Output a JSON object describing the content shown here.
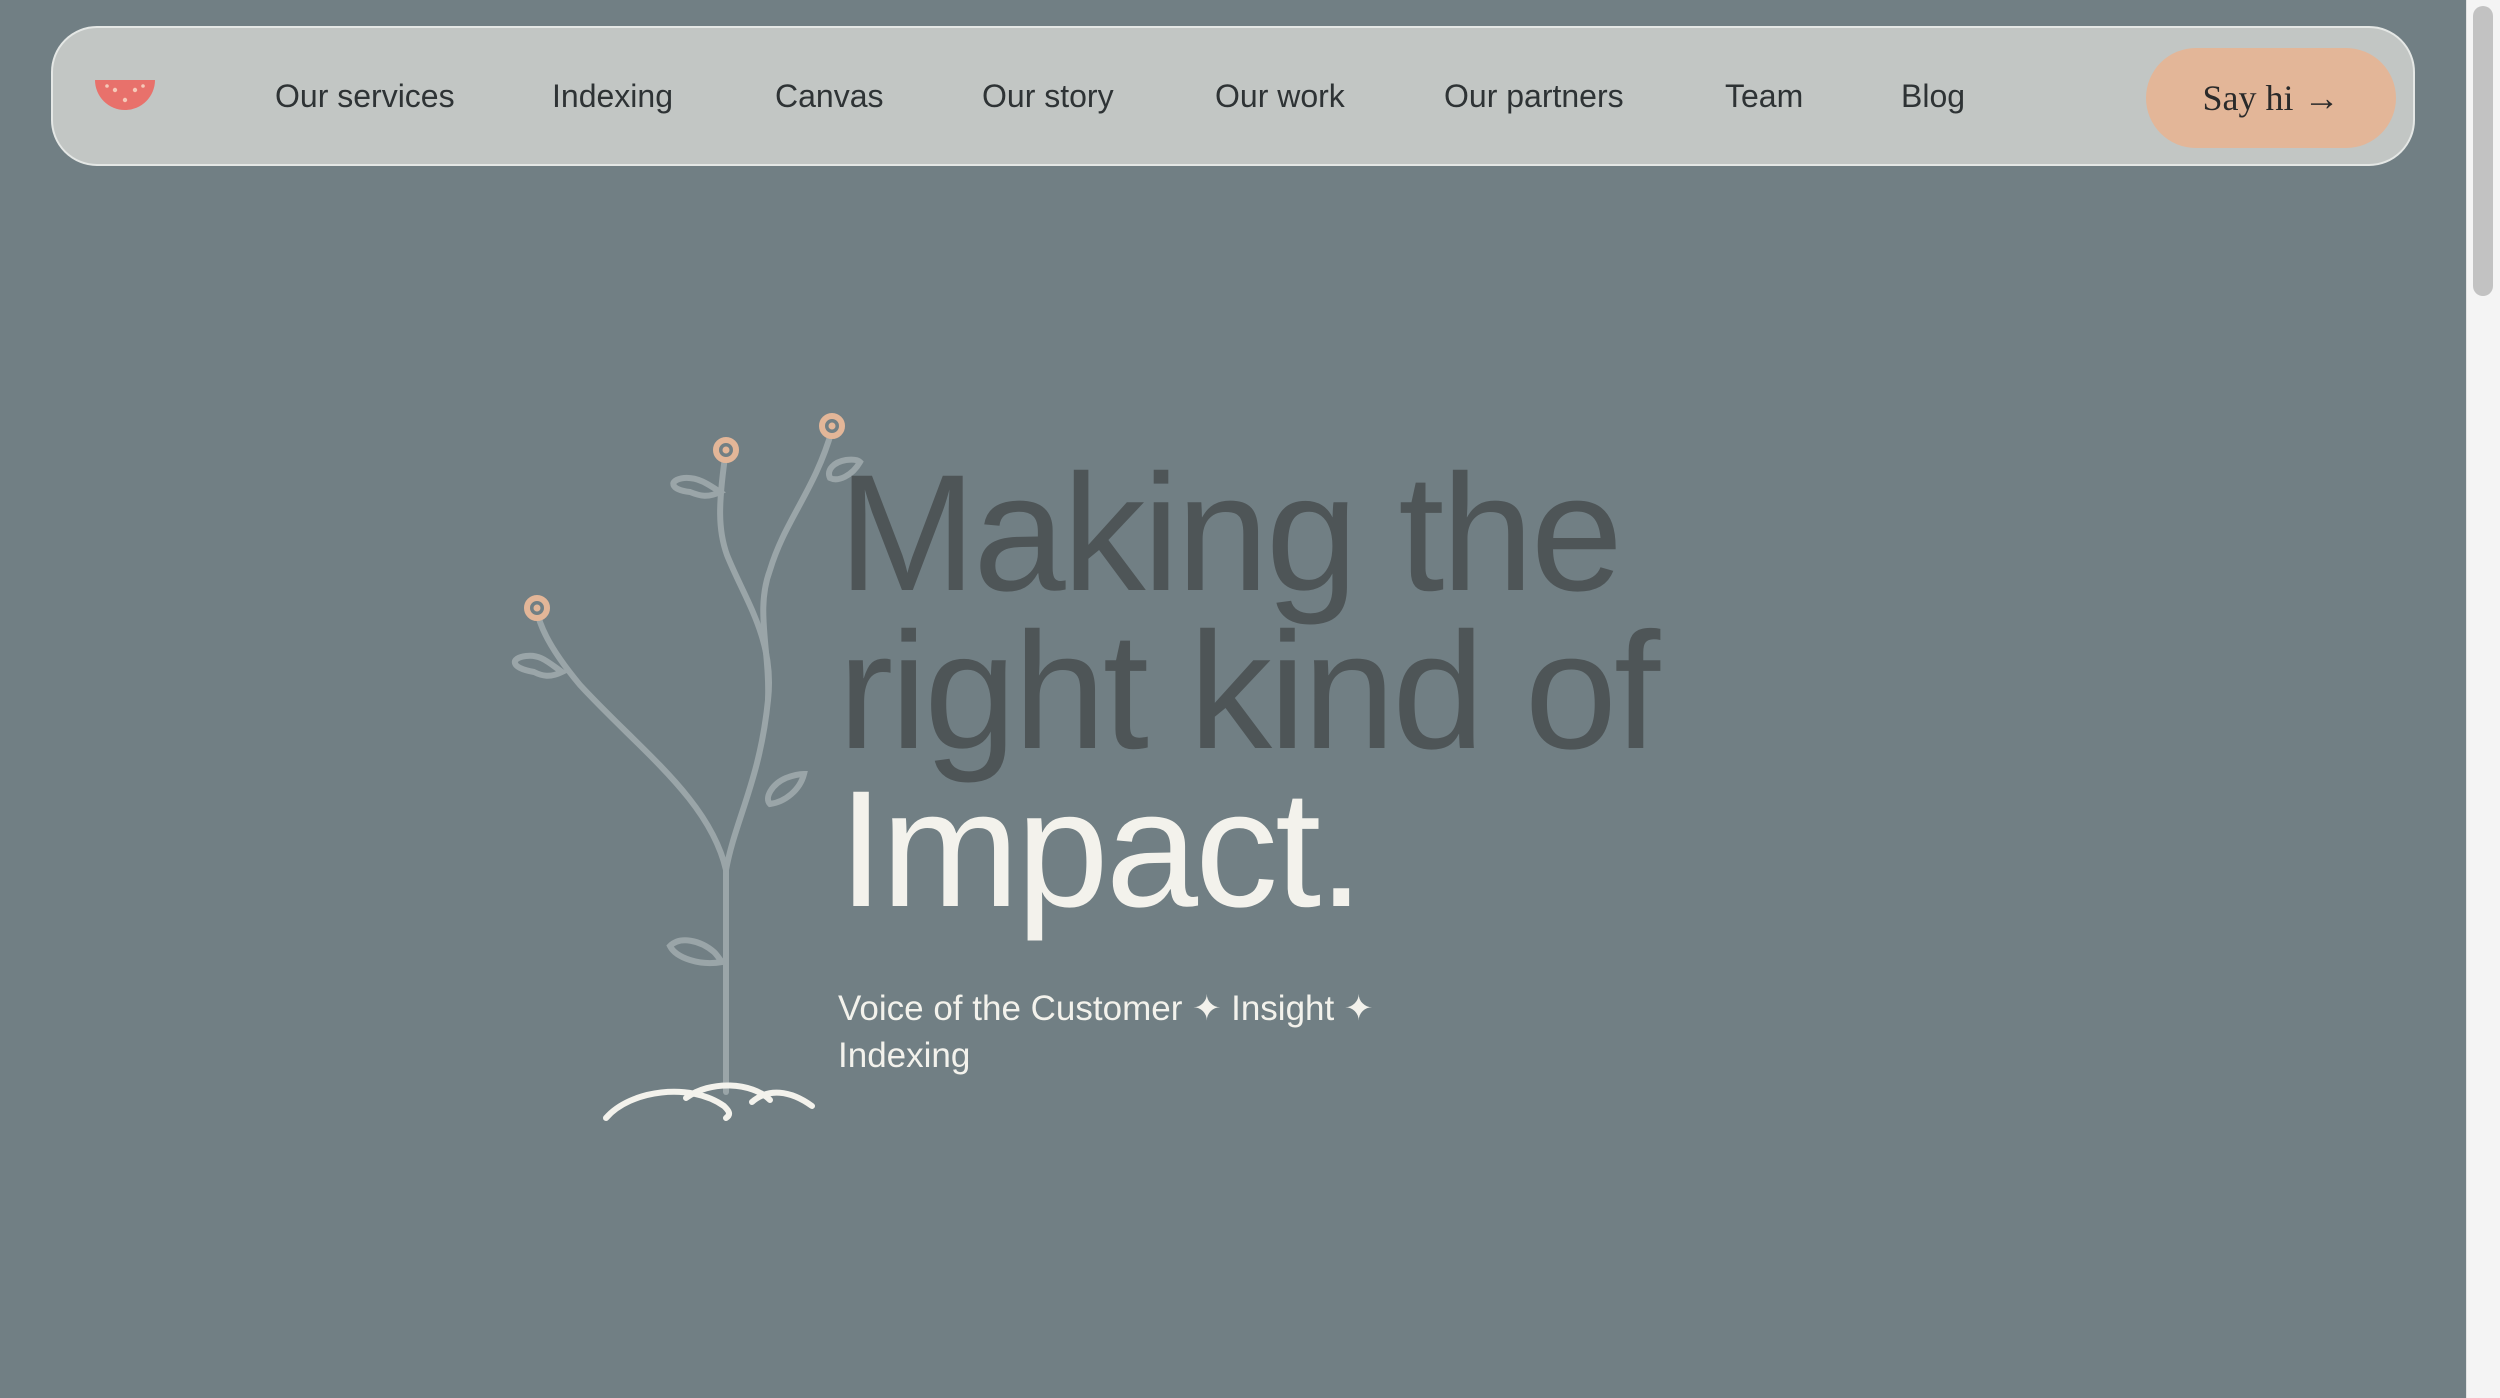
{
  "nav": {
    "logo_icon": "watermelon-slice-icon",
    "links": [
      {
        "label": "Our services"
      },
      {
        "label": "Indexing"
      },
      {
        "label": "Canvas"
      },
      {
        "label": "Our story"
      },
      {
        "label": "Our work"
      },
      {
        "label": "Our partners"
      },
      {
        "label": "Team"
      },
      {
        "label": "Blog"
      }
    ],
    "cta_label": "Say hi",
    "cta_icon": "arrow-right-icon",
    "cta_arrow": "→"
  },
  "hero": {
    "headline_line1": "Making the",
    "headline_line2": "right kind of",
    "headline_line3": "Impact.",
    "tagline": "Voice of the Customer ✦ Insight ✦ Indexing",
    "illustration_icon": "plant-sprout-icon"
  },
  "colors": {
    "background": "#717f84",
    "nav_background": "#c2c6c4",
    "cta_background": "#e3b698",
    "headline_dark": "#4e5557",
    "headline_light": "#f3f2ec",
    "logo": "#e8716b",
    "flower": "#e3b698"
  }
}
